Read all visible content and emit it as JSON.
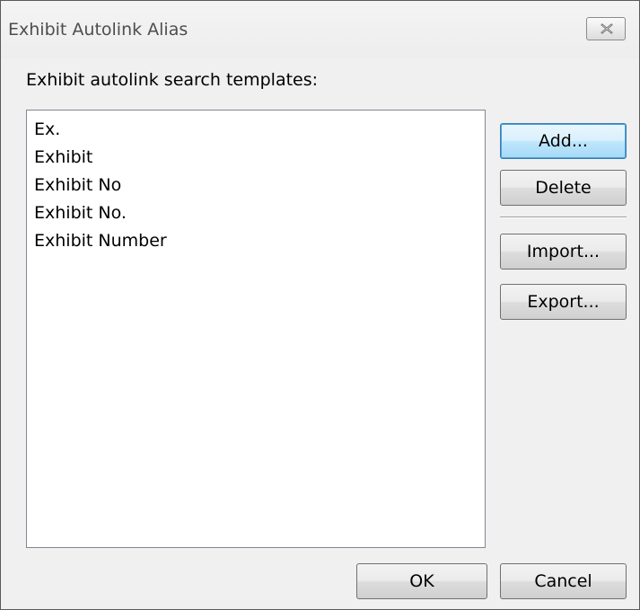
{
  "window": {
    "title": "Exhibit Autolink Alias"
  },
  "prompt_label": "Exhibit autolink search templates:",
  "templates": [
    "Ex.",
    "Exhibit",
    "Exhibit No",
    "Exhibit No.",
    "Exhibit Number"
  ],
  "buttons": {
    "add": "Add...",
    "delete": "Delete",
    "import": "Import...",
    "export": "Export...",
    "ok": "OK",
    "cancel": "Cancel"
  },
  "icons": {
    "close": "close-icon"
  },
  "colors": {
    "default_button_border": "#3c7fb1",
    "dialog_background": "#f0f0f0"
  }
}
